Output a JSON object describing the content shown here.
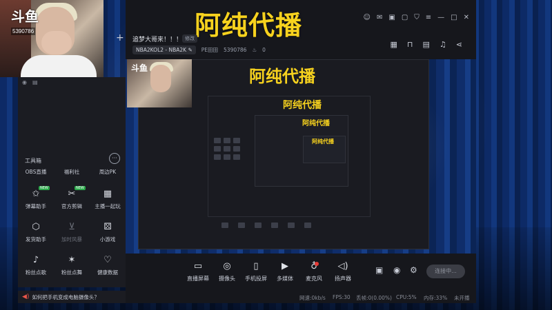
{
  "brand_logo": "斗鱼",
  "cam": {
    "room_id": "5390786"
  },
  "window": {
    "title": "阿纯代播",
    "system_icons": [
      "avatar-icon",
      "mail-icon",
      "gift-icon",
      "message-icon",
      "shirt-icon",
      "menu-icon",
      "minimize-icon",
      "maximize-icon",
      "close-icon"
    ]
  },
  "room": {
    "title": "追梦大哥来！！！",
    "edit_label": "修改",
    "category": "NBA2KOL2 - NBA2K",
    "owner": "PE田田",
    "room_number": "5390786",
    "heat": "0"
  },
  "toolbox": {
    "title": "工具箱",
    "top_items": [
      "OBS直播",
      "福利社",
      "周边PK"
    ],
    "items": [
      {
        "label": "弹幕助手",
        "icon": "danmaku-icon",
        "badge": "NEW",
        "enabled": true
      },
      {
        "label": "官方剪辑",
        "icon": "scissors-icon",
        "badge": "NEW",
        "enabled": true
      },
      {
        "label": "主播一起玩",
        "icon": "clipboard-icon",
        "badge": "",
        "enabled": true
      },
      {
        "label": "发货助手",
        "icon": "box-icon",
        "badge": "",
        "enabled": true
      },
      {
        "label": "加时风暴",
        "icon": "download-icon",
        "badge": "",
        "enabled": false
      },
      {
        "label": "小游戏",
        "icon": "gamepad-icon",
        "badge": "",
        "enabled": true
      },
      {
        "label": "粉丝点歌",
        "icon": "music-icon",
        "badge": "",
        "enabled": true
      },
      {
        "label": "粉丝点舞",
        "icon": "dance-icon",
        "badge": "",
        "enabled": true
      },
      {
        "label": "健康数据",
        "icon": "heart-pulse-icon",
        "badge": "",
        "enabled": true
      }
    ]
  },
  "controls": {
    "buttons": [
      {
        "label": "直播屏幕",
        "icon": "screen-icon"
      },
      {
        "label": "摄像头",
        "icon": "camera-icon"
      },
      {
        "label": "手机投屏",
        "icon": "phone-icon"
      },
      {
        "label": "多媒体",
        "icon": "media-icon"
      },
      {
        "label": "麦克风",
        "icon": "mic-icon"
      },
      {
        "label": "扬声器",
        "icon": "speaker-icon"
      }
    ],
    "connect_label": "连接中..."
  },
  "status": {
    "upload": "网速:0kb/s",
    "fps": "FPS:30",
    "drop": "丢帧:0(0.00%)",
    "cpu": "CPU:5%",
    "memory": "内存:33%",
    "live_state": "未开播"
  },
  "tip": "如何把手机变成电脑摄像头？",
  "colors": {
    "title_yellow": "#f7d21e",
    "panel_bg": "#1b1c22",
    "mic_red": "#e53935"
  }
}
